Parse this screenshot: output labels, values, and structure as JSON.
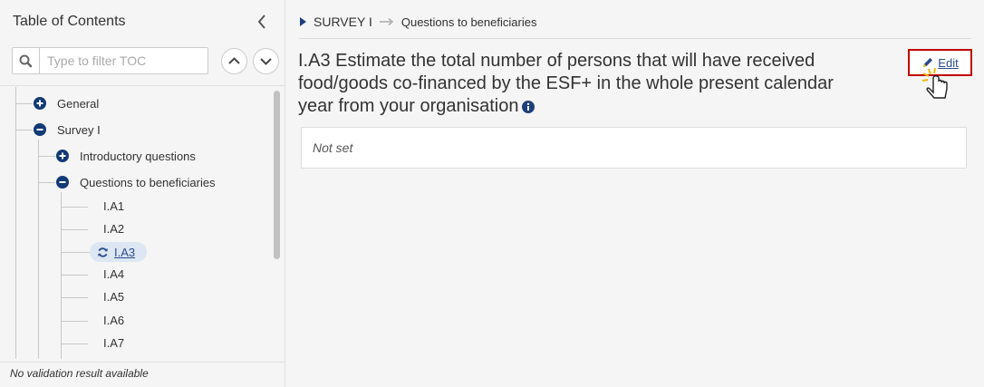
{
  "toc": {
    "title": "Table of Contents",
    "filter_placeholder": "Type to filter TOC",
    "validation_status": "No validation result available"
  },
  "tree": {
    "general": "General",
    "survey": "Survey I",
    "intro": "Introductory questions",
    "beneficiaries": "Questions to beneficiaries",
    "items": [
      "I.A1",
      "I.A2",
      "I.A3",
      "I.A4",
      "I.A5",
      "I.A6",
      "I.A7"
    ]
  },
  "breadcrumb": {
    "section": "SURVEY I",
    "current": "Questions to beneficiaries"
  },
  "question": {
    "title": "I.A3 Estimate the total number of persons that will have received food/goods co-financed by the ESF+ in the whole present calendar year from your organisation",
    "value": "Not set"
  },
  "actions": {
    "edit_label": "Edit"
  },
  "colors": {
    "accent": "#2a4b8d",
    "highlight_border": "#c00000",
    "active_bg": "#dce7f3"
  },
  "icons": {
    "collapse": "chevron-left-icon",
    "search": "search-icon",
    "up": "chevron-up-icon",
    "down": "chevron-down-icon",
    "expand": "plus-circle-icon",
    "collapse_node": "minus-circle-icon",
    "refresh": "refresh-icon",
    "info": "info-icon",
    "edit": "pencil-icon",
    "cursor": "hand-cursor-icon"
  }
}
